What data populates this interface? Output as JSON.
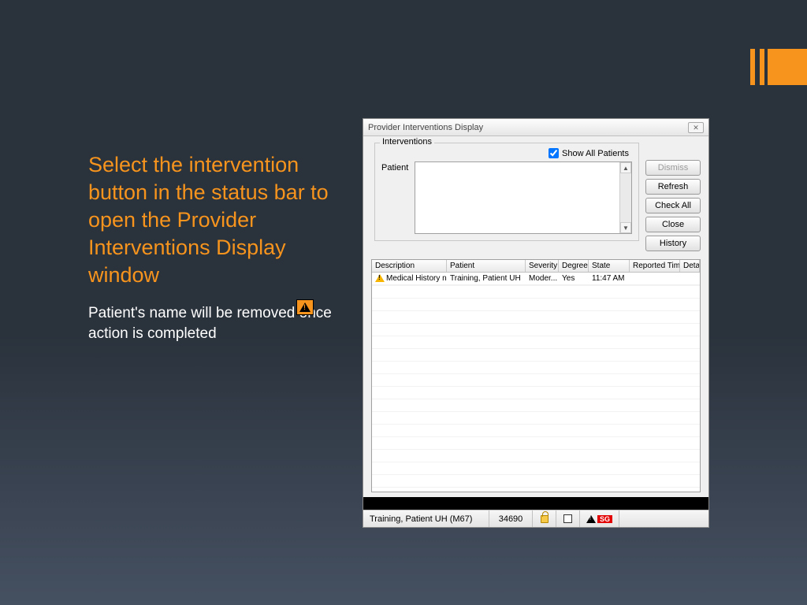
{
  "slide": {
    "heading": "Select the intervention button in the status bar to open the Provider Interventions Display window",
    "sub": "Patient's name will be removed once action is completed"
  },
  "dialog": {
    "title": "Provider Interventions Display",
    "close_glyph": "✕",
    "legend": "Interventions",
    "show_all_label": "Show All Patients",
    "show_all_checked": true,
    "patient_label": "Patient",
    "buttons": {
      "dismiss": "Dismiss",
      "refresh": "Refresh",
      "check_all": "Check All",
      "close": "Close",
      "history": "History"
    },
    "columns": {
      "description": "Description",
      "patient": "Patient",
      "severity": "Severity",
      "degree": "Degree",
      "state": "State",
      "reported_time": "Reported Time",
      "details": "Details"
    },
    "rows": [
      {
        "description": "Medical History nee...",
        "patient": "Training, Patient UH",
        "severity": "Moder...",
        "degree": "Yes",
        "state": "11:47 AM",
        "reported_time": "",
        "details": ""
      }
    ]
  },
  "status": {
    "patient": "Training, Patient UH (M67)",
    "number": "34690",
    "sg": "SG"
  }
}
